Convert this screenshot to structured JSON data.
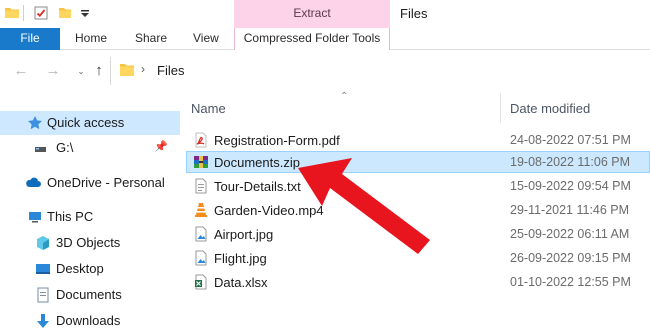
{
  "titlebar": {
    "quick_access_icons": [
      "folder-icon",
      "properties-icon",
      "new-folder-icon",
      "customize-quick-access-icon"
    ],
    "contextual_tab": "Extract",
    "window_title": "Files"
  },
  "ribbon": {
    "file_tab": "File",
    "tabs": [
      "Home",
      "Share",
      "View"
    ],
    "contextual_tab": "Compressed Folder Tools"
  },
  "address": {
    "path_segment": "Files",
    "nav_buttons": [
      "back",
      "forward",
      "recent-locations",
      "up"
    ]
  },
  "nav_pane": {
    "items": [
      {
        "label": "Quick access",
        "icon": "star-icon"
      },
      {
        "label": "G:\\",
        "icon": "drive-icon"
      },
      {
        "label": "OneDrive - Personal",
        "icon": "cloud-icon"
      },
      {
        "label": "This PC",
        "icon": "computer-icon"
      },
      {
        "label": "3D Objects",
        "icon": "cube-icon"
      },
      {
        "label": "Desktop",
        "icon": "desktop-icon"
      },
      {
        "label": "Documents",
        "icon": "document-icon"
      },
      {
        "label": "Downloads",
        "icon": "download-icon"
      }
    ]
  },
  "columns": {
    "name": "Name",
    "date_modified": "Date modified"
  },
  "files": [
    {
      "name": "Registration-Form.pdf",
      "date": "24-08-2022 07:51 PM",
      "icon": "pdf-icon",
      "selected": false
    },
    {
      "name": "Documents.zip",
      "date": "19-08-2022 11:06 PM",
      "icon": "zip-archive-icon",
      "selected": true
    },
    {
      "name": "Tour-Details.txt",
      "date": "15-09-2022 09:54 PM",
      "icon": "text-file-icon",
      "selected": false
    },
    {
      "name": "Garden-Video.mp4",
      "date": "29-11-2021 11:46 PM",
      "icon": "vlc-video-icon",
      "selected": false
    },
    {
      "name": "Airport.jpg",
      "date": "25-09-2022 06:11 AM",
      "icon": "image-file-icon",
      "selected": false
    },
    {
      "name": "Flight.jpg",
      "date": "26-09-2022 09:15 PM",
      "icon": "image-file-icon",
      "selected": false
    },
    {
      "name": "Data.xlsx",
      "date": "01-10-2022 12:55 PM",
      "icon": "excel-icon",
      "selected": false
    }
  ],
  "colors": {
    "file_tab": "#1979ca",
    "contextual_tab": "#fcd3e9",
    "selection": "#cce8ff",
    "annotation_arrow": "#e8141e"
  }
}
